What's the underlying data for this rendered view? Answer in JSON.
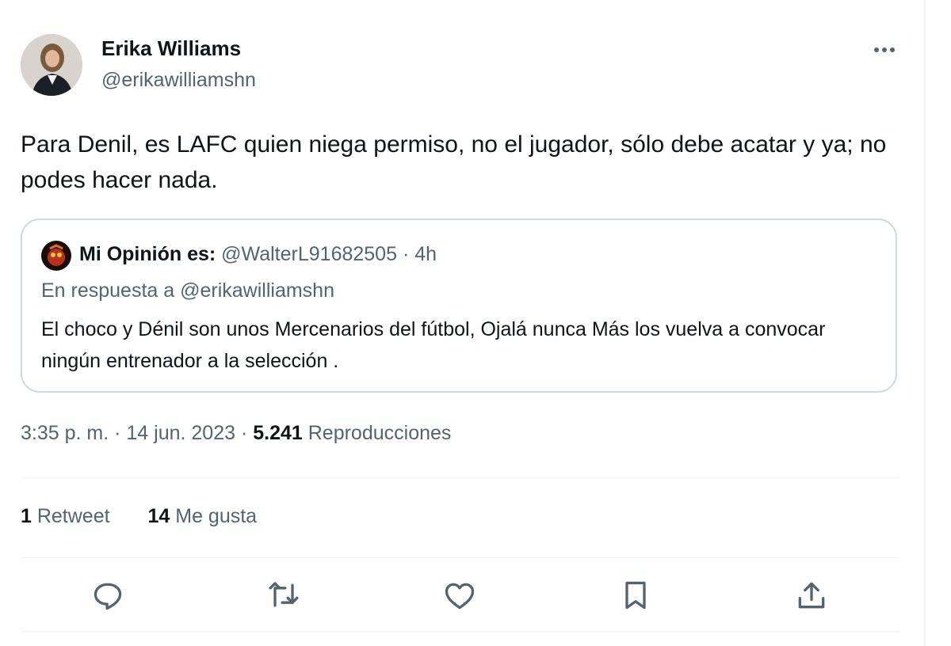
{
  "author": {
    "name": "Erika Williams",
    "handle": "@erikawilliamshn"
  },
  "tweet": {
    "text": "Para Denil, es LAFC quien niega permiso, no el jugador, sólo debe acatar y ya; no podes hacer nada."
  },
  "quote": {
    "name": "Mi Opinión es:",
    "handle": "@WalterL91682505",
    "separator": " · ",
    "time": "4h",
    "reply_to": "En respuesta a @erikawilliamshn",
    "text": "El choco y Dénil son unos Mercenarios del fútbol, Ojalá nunca Más los vuelva a convocar ningún entrenador a la selección ."
  },
  "meta": {
    "time": "3:35 p. m.",
    "sep1": " · ",
    "date": "14 jun. 2023",
    "sep2": " · ",
    "views_count": "5.241",
    "views_label": " Reproducciones"
  },
  "stats": {
    "retweets_count": "1",
    "retweets_label": " Retweet",
    "likes_count": "14",
    "likes_label": " Me gusta"
  },
  "icons": {
    "more": "more-icon",
    "reply": "reply-icon",
    "retweet": "retweet-icon",
    "like": "heart-icon",
    "bookmark": "bookmark-icon",
    "share": "share-icon"
  },
  "colors": {
    "text_primary": "#0f1419",
    "text_secondary": "#536471",
    "border": "#cfd9de",
    "divider": "#eff3f4"
  }
}
